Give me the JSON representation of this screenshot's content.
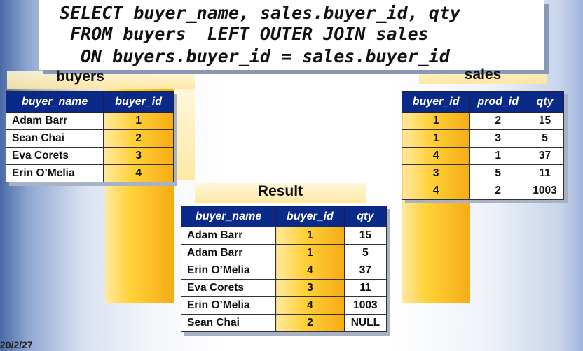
{
  "sql": {
    "line1": "SELECT buyer_name, sales.buyer_id, qty",
    "line2": "FROM buyers  LEFT OUTER JOIN sales",
    "line3": "ON buyers.buyer_id = sales.buyer_id"
  },
  "buyers": {
    "title": "buyers",
    "headers": [
      "buyer_name",
      "buyer_id"
    ],
    "rows": [
      [
        "Adam Barr",
        "1"
      ],
      [
        "Sean Chai",
        "2"
      ],
      [
        "Eva Corets",
        "3"
      ],
      [
        "Erin O’Melia",
        "4"
      ]
    ]
  },
  "sales": {
    "title": "sales",
    "headers": [
      "buyer_id",
      "prod_id",
      "qty"
    ],
    "rows": [
      [
        "1",
        "2",
        "15"
      ],
      [
        "1",
        "3",
        "5"
      ],
      [
        "4",
        "1",
        "37"
      ],
      [
        "3",
        "5",
        "11"
      ],
      [
        "4",
        "2",
        "1003"
      ]
    ]
  },
  "result": {
    "title": "Result",
    "headers": [
      "buyer_name",
      "buyer_id",
      "qty"
    ],
    "rows": [
      [
        "Adam Barr",
        "1",
        "15"
      ],
      [
        "Adam Barr",
        "1",
        "5"
      ],
      [
        "Erin O’Melia",
        "4",
        "37"
      ],
      [
        "Eva Corets",
        "3",
        "11"
      ],
      [
        "Erin O’Melia",
        "4",
        "1003"
      ],
      [
        "Sean Chai",
        "2",
        "NULL"
      ]
    ]
  },
  "footer": {
    "date": "20/2/27"
  },
  "colors": {
    "header_bg": "#0a2a8a",
    "key_gold": "#ffd23a"
  }
}
